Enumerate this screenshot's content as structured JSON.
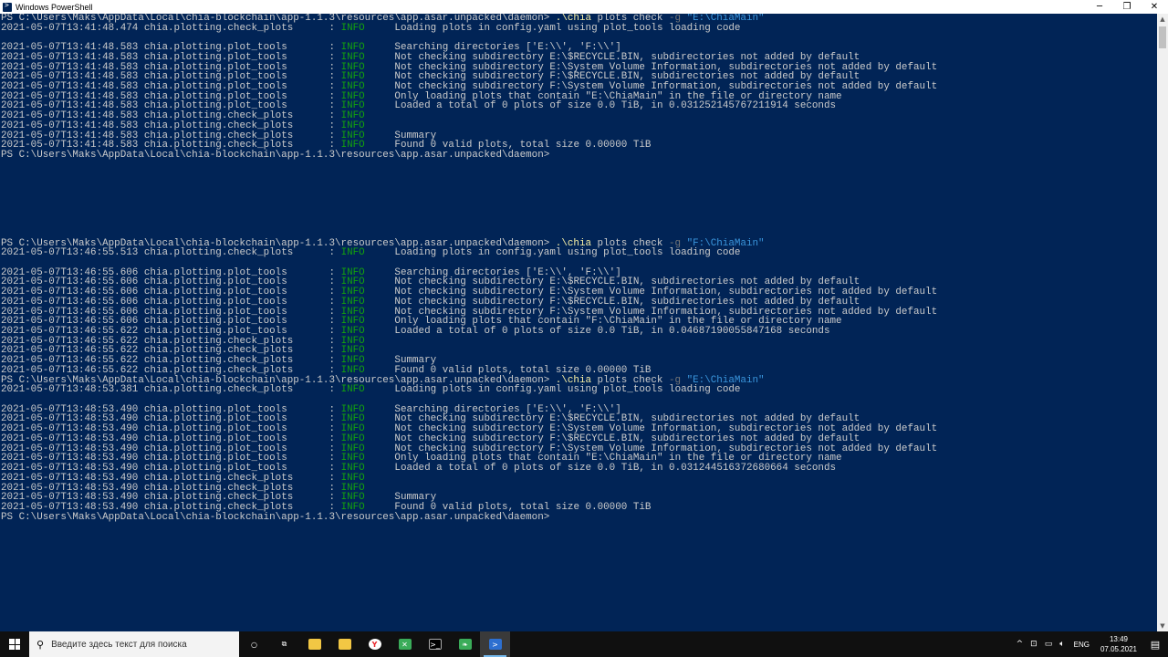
{
  "window": {
    "title": "Windows PowerShell",
    "minimize_icon": "minimize-icon",
    "maximize_icon": "restore-icon",
    "close_icon": "close-icon"
  },
  "colors": {
    "background": "#012456",
    "text": "#cccccc",
    "info": "#13a10e",
    "command_exe": "#f9f1a5",
    "command_flag": "#767676",
    "command_string": "#3a96dd"
  },
  "terminal": {
    "lines": [
      {
        "type": "cmd",
        "prompt": "PS C:\\Users\\Maks\\AppData\\Local\\chia-blockchain\\app-1.1.3\\resources\\app.asar.unpacked\\daemon> ",
        "exe": ".\\chia",
        "args": " plots check ",
        "flag": "-g",
        "str": " \"E:\\ChiaMain\""
      },
      {
        "type": "log",
        "ts": "2021-05-07T13:41:48.474",
        "mod": "chia.plotting.check_plots",
        "level": "INFO",
        "msg": "Loading plots in config.yaml using plot_tools loading code"
      },
      {
        "type": "blank"
      },
      {
        "type": "log",
        "ts": "2021-05-07T13:41:48.583",
        "mod": "chia.plotting.plot_tools",
        "level": "INFO",
        "msg": "Searching directories ['E:\\\\', 'F:\\\\']"
      },
      {
        "type": "log",
        "ts": "2021-05-07T13:41:48.583",
        "mod": "chia.plotting.plot_tools",
        "level": "INFO",
        "msg": "Not checking subdirectory E:\\$RECYCLE.BIN, subdirectories not added by default"
      },
      {
        "type": "log",
        "ts": "2021-05-07T13:41:48.583",
        "mod": "chia.plotting.plot_tools",
        "level": "INFO",
        "msg": "Not checking subdirectory E:\\System Volume Information, subdirectories not added by default"
      },
      {
        "type": "log",
        "ts": "2021-05-07T13:41:48.583",
        "mod": "chia.plotting.plot_tools",
        "level": "INFO",
        "msg": "Not checking subdirectory F:\\$RECYCLE.BIN, subdirectories not added by default"
      },
      {
        "type": "log",
        "ts": "2021-05-07T13:41:48.583",
        "mod": "chia.plotting.plot_tools",
        "level": "INFO",
        "msg": "Not checking subdirectory F:\\System Volume Information, subdirectories not added by default"
      },
      {
        "type": "log",
        "ts": "2021-05-07T13:41:48.583",
        "mod": "chia.plotting.plot_tools",
        "level": "INFO",
        "msg": "Only loading plots that contain \"E:\\ChiaMain\" in the file or directory name"
      },
      {
        "type": "log",
        "ts": "2021-05-07T13:41:48.583",
        "mod": "chia.plotting.plot_tools",
        "level": "INFO",
        "msg": "Loaded a total of 0 plots of size 0.0 TiB, in 0.031252145767211914 seconds"
      },
      {
        "type": "log",
        "ts": "2021-05-07T13:41:48.583",
        "mod": "chia.plotting.check_plots",
        "level": "INFO",
        "msg": ""
      },
      {
        "type": "log",
        "ts": "2021-05-07T13:41:48.583",
        "mod": "chia.plotting.check_plots",
        "level": "INFO",
        "msg": ""
      },
      {
        "type": "log",
        "ts": "2021-05-07T13:41:48.583",
        "mod": "chia.plotting.check_plots",
        "level": "INFO",
        "msg": "Summary"
      },
      {
        "type": "log",
        "ts": "2021-05-07T13:41:48.583",
        "mod": "chia.plotting.check_plots",
        "level": "INFO",
        "msg": "Found 0 valid plots, total size 0.00000 TiB"
      },
      {
        "type": "prompt",
        "prompt": "PS C:\\Users\\Maks\\AppData\\Local\\chia-blockchain\\app-1.1.3\\resources\\app.asar.unpacked\\daemon>"
      },
      {
        "type": "blank"
      },
      {
        "type": "blank"
      },
      {
        "type": "blank"
      },
      {
        "type": "blank"
      },
      {
        "type": "blank"
      },
      {
        "type": "blank"
      },
      {
        "type": "blank"
      },
      {
        "type": "blank"
      },
      {
        "type": "cmd",
        "prompt": "PS C:\\Users\\Maks\\AppData\\Local\\chia-blockchain\\app-1.1.3\\resources\\app.asar.unpacked\\daemon> ",
        "exe": ".\\chia",
        "args": " plots check ",
        "flag": "-g",
        "str": " \"F:\\ChiaMain\""
      },
      {
        "type": "log",
        "ts": "2021-05-07T13:46:55.513",
        "mod": "chia.plotting.check_plots",
        "level": "INFO",
        "msg": "Loading plots in config.yaml using plot_tools loading code"
      },
      {
        "type": "blank"
      },
      {
        "type": "log",
        "ts": "2021-05-07T13:46:55.606",
        "mod": "chia.plotting.plot_tools",
        "level": "INFO",
        "msg": "Searching directories ['E:\\\\', 'F:\\\\']"
      },
      {
        "type": "log",
        "ts": "2021-05-07T13:46:55.606",
        "mod": "chia.plotting.plot_tools",
        "level": "INFO",
        "msg": "Not checking subdirectory E:\\$RECYCLE.BIN, subdirectories not added by default"
      },
      {
        "type": "log",
        "ts": "2021-05-07T13:46:55.606",
        "mod": "chia.plotting.plot_tools",
        "level": "INFO",
        "msg": "Not checking subdirectory E:\\System Volume Information, subdirectories not added by default"
      },
      {
        "type": "log",
        "ts": "2021-05-07T13:46:55.606",
        "mod": "chia.plotting.plot_tools",
        "level": "INFO",
        "msg": "Not checking subdirectory F:\\$RECYCLE.BIN, subdirectories not added by default"
      },
      {
        "type": "log",
        "ts": "2021-05-07T13:46:55.606",
        "mod": "chia.plotting.plot_tools",
        "level": "INFO",
        "msg": "Not checking subdirectory F:\\System Volume Information, subdirectories not added by default"
      },
      {
        "type": "log",
        "ts": "2021-05-07T13:46:55.606",
        "mod": "chia.plotting.plot_tools",
        "level": "INFO",
        "msg": "Only loading plots that contain \"F:\\ChiaMain\" in the file or directory name"
      },
      {
        "type": "log",
        "ts": "2021-05-07T13:46:55.622",
        "mod": "chia.plotting.plot_tools",
        "level": "INFO",
        "msg": "Loaded a total of 0 plots of size 0.0 TiB, in 0.04687190055847168 seconds"
      },
      {
        "type": "log",
        "ts": "2021-05-07T13:46:55.622",
        "mod": "chia.plotting.check_plots",
        "level": "INFO",
        "msg": ""
      },
      {
        "type": "log",
        "ts": "2021-05-07T13:46:55.622",
        "mod": "chia.plotting.check_plots",
        "level": "INFO",
        "msg": ""
      },
      {
        "type": "log",
        "ts": "2021-05-07T13:46:55.622",
        "mod": "chia.plotting.check_plots",
        "level": "INFO",
        "msg": "Summary"
      },
      {
        "type": "log",
        "ts": "2021-05-07T13:46:55.622",
        "mod": "chia.plotting.check_plots",
        "level": "INFO",
        "msg": "Found 0 valid plots, total size 0.00000 TiB"
      },
      {
        "type": "cmd",
        "prompt": "PS C:\\Users\\Maks\\AppData\\Local\\chia-blockchain\\app-1.1.3\\resources\\app.asar.unpacked\\daemon> ",
        "exe": ".\\chia",
        "args": " plots check ",
        "flag": "-g",
        "str": " \"E:\\ChiaMain\""
      },
      {
        "type": "log",
        "ts": "2021-05-07T13:48:53.381",
        "mod": "chia.plotting.check_plots",
        "level": "INFO",
        "msg": "Loading plots in config.yaml using plot_tools loading code"
      },
      {
        "type": "blank"
      },
      {
        "type": "log",
        "ts": "2021-05-07T13:48:53.490",
        "mod": "chia.plotting.plot_tools",
        "level": "INFO",
        "msg": "Searching directories ['E:\\\\', 'F:\\\\']"
      },
      {
        "type": "log",
        "ts": "2021-05-07T13:48:53.490",
        "mod": "chia.plotting.plot_tools",
        "level": "INFO",
        "msg": "Not checking subdirectory E:\\$RECYCLE.BIN, subdirectories not added by default"
      },
      {
        "type": "log",
        "ts": "2021-05-07T13:48:53.490",
        "mod": "chia.plotting.plot_tools",
        "level": "INFO",
        "msg": "Not checking subdirectory E:\\System Volume Information, subdirectories not added by default"
      },
      {
        "type": "log",
        "ts": "2021-05-07T13:48:53.490",
        "mod": "chia.plotting.plot_tools",
        "level": "INFO",
        "msg": "Not checking subdirectory F:\\$RECYCLE.BIN, subdirectories not added by default"
      },
      {
        "type": "log",
        "ts": "2021-05-07T13:48:53.490",
        "mod": "chia.plotting.plot_tools",
        "level": "INFO",
        "msg": "Not checking subdirectory F:\\System Volume Information, subdirectories not added by default"
      },
      {
        "type": "log",
        "ts": "2021-05-07T13:48:53.490",
        "mod": "chia.plotting.plot_tools",
        "level": "INFO",
        "msg": "Only loading plots that contain \"E:\\ChiaMain\" in the file or directory name"
      },
      {
        "type": "log",
        "ts": "2021-05-07T13:48:53.490",
        "mod": "chia.plotting.plot_tools",
        "level": "INFO",
        "msg": "Loaded a total of 0 plots of size 0.0 TiB, in 0.031244516372680664 seconds"
      },
      {
        "type": "log",
        "ts": "2021-05-07T13:48:53.490",
        "mod": "chia.plotting.check_plots",
        "level": "INFO",
        "msg": ""
      },
      {
        "type": "log",
        "ts": "2021-05-07T13:48:53.490",
        "mod": "chia.plotting.check_plots",
        "level": "INFO",
        "msg": ""
      },
      {
        "type": "log",
        "ts": "2021-05-07T13:48:53.490",
        "mod": "chia.plotting.check_plots",
        "level": "INFO",
        "msg": "Summary"
      },
      {
        "type": "log",
        "ts": "2021-05-07T13:48:53.490",
        "mod": "chia.plotting.check_plots",
        "level": "INFO",
        "msg": "Found 0 valid plots, total size 0.00000 TiB"
      },
      {
        "type": "prompt",
        "prompt": "PS C:\\Users\\Maks\\AppData\\Local\\chia-blockchain\\app-1.1.3\\resources\\app.asar.unpacked\\daemon>"
      }
    ]
  },
  "taskbar": {
    "search_placeholder": "Введите здесь текст для поиска",
    "apps": [
      {
        "name": "task-view-icon",
        "glyph": "○",
        "active": false
      },
      {
        "name": "timeline-icon",
        "glyph": "⧉",
        "active": false
      },
      {
        "name": "file-explorer-icon",
        "glyph": "",
        "active": false,
        "color": "#f2c744"
      },
      {
        "name": "store-icon",
        "glyph": "",
        "active": false,
        "color": "#f2c744"
      },
      {
        "name": "yandex-browser-icon",
        "glyph": "Y",
        "active": false,
        "color": "#e8252a"
      },
      {
        "name": "chia-app-icon",
        "glyph": "✕",
        "active": false,
        "color": "#3aac59"
      },
      {
        "name": "command-prompt-icon",
        "glyph": ">_",
        "active": false,
        "color": "#000000"
      },
      {
        "name": "chia-leaf-icon",
        "glyph": "❧",
        "active": false,
        "color": "#3aac59"
      },
      {
        "name": "powershell-icon",
        "glyph": ">",
        "active": true,
        "color": "#2d6fd0"
      }
    ],
    "tray": {
      "chevron": "^",
      "language": "ENG",
      "time": "13:49",
      "date": "07.05.2021"
    }
  }
}
